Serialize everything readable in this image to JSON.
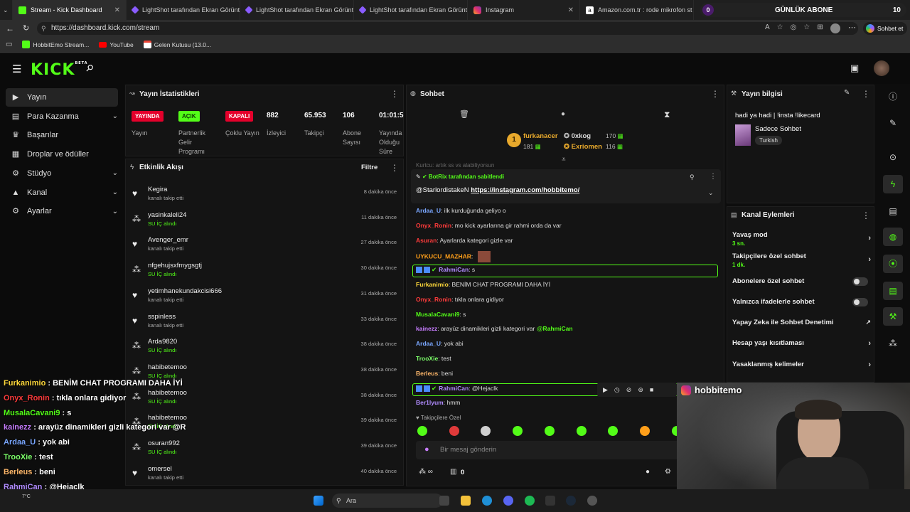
{
  "browser": {
    "tabs": [
      {
        "label": "Stream - Kick Dashboard",
        "active": true
      },
      {
        "label": "LightShot tarafından Ekran Görünt"
      },
      {
        "label": "LightShot tarafından Ekran Görünt"
      },
      {
        "label": "LightShot tarafından Ekran Görünt"
      },
      {
        "label": "Instagram"
      },
      {
        "label": "Amazon.com.tr : rode mikrofon st"
      }
    ],
    "overlay_tab_badge": "0",
    "overlay_tab_text": "GÜNLÜK ABONE",
    "overlay_tab_count": "10",
    "url": "https://dashboard.kick.com/stream",
    "profile_button": "Sohbet et",
    "bookmarks": [
      "HobbitEmo Stream...",
      "YouTube",
      "Gelen Kutusu (13.0..."
    ]
  },
  "brand": {
    "logo": "KICK",
    "beta": "BETA",
    "accent": "#53fc18"
  },
  "sidebar": {
    "items": [
      {
        "label": "Yayın",
        "icon": "video-icon",
        "active": true
      },
      {
        "label": "Para Kazanma",
        "icon": "money-icon",
        "expandable": true
      },
      {
        "label": "Başarılar",
        "icon": "trophy-icon"
      },
      {
        "label": "Droplar ve ödüller",
        "icon": "gift-icon"
      },
      {
        "label": "Stüdyo",
        "icon": "gear-icon",
        "expandable": true
      },
      {
        "label": "Kanal",
        "icon": "user-icon",
        "expandable": true
      },
      {
        "label": "Ayarlar",
        "icon": "settings-icon",
        "expandable": true
      }
    ]
  },
  "stats": {
    "title": "Yayın İstatistikleri",
    "items": [
      {
        "value": "YAYINDA",
        "label": "Yayın",
        "type": "badge",
        "color": "#e4002b"
      },
      {
        "value": "AÇIK",
        "label": "Partnerlik Gelir Programı",
        "type": "badge",
        "color": "#53fc18"
      },
      {
        "value": "KAPALI",
        "label": "Çoklu Yayın",
        "type": "badge",
        "color": "#e4002b"
      },
      {
        "value": "882",
        "label": "İzleyici"
      },
      {
        "value": "65.953",
        "label": "Takipçi"
      },
      {
        "value": "106",
        "label": "Abone Sayısı"
      },
      {
        "value": "01:01:5",
        "label": "Yayında Olduğu Süre"
      }
    ]
  },
  "activity": {
    "title": "Etkinlik Akışı",
    "filter": "Filtre",
    "events": [
      {
        "name": "Kegira",
        "desc": "kanalı takip etti",
        "time": "8 dakika önce",
        "type": "follow"
      },
      {
        "name": "yasinkaleli24",
        "desc": "SU İÇ alındı",
        "time": "11 dakika önce",
        "type": "reward"
      },
      {
        "name": "Avenger_emr",
        "desc": "kanalı takip etti",
        "time": "27 dakika önce",
        "type": "follow"
      },
      {
        "name": "nfgehujsxfmygsgtj",
        "desc": "SU İÇ alındı",
        "time": "30 dakika önce",
        "type": "reward"
      },
      {
        "name": "yetimhanekundakcisi666",
        "desc": "kanalı takip etti",
        "time": "31 dakika önce",
        "type": "follow"
      },
      {
        "name": "sspinless",
        "desc": "kanalı takip etti",
        "time": "33 dakika önce",
        "type": "follow"
      },
      {
        "name": "Arda9820",
        "desc": "SU İÇ alındı",
        "time": "38 dakika önce",
        "type": "reward"
      },
      {
        "name": "habibetemoo",
        "desc": "SU İÇ alındı",
        "time": "38 dakika önce",
        "type": "reward"
      },
      {
        "name": "habibetemoo",
        "desc": "SU İÇ alındı",
        "time": "38 dakika önce",
        "type": "reward"
      },
      {
        "name": "habibetemoo",
        "desc": "SU İÇ alındı",
        "time": "39 dakika önce",
        "type": "reward"
      },
      {
        "name": "osuran992",
        "desc": "SU İÇ alındı",
        "time": "39 dakika önce",
        "type": "reward"
      },
      {
        "name": "omersel",
        "desc": "kanalı takip etti",
        "time": "40 dakika önce",
        "type": "follow"
      }
    ]
  },
  "chat": {
    "title": "Sohbet",
    "top_gifter": {
      "rank": "1",
      "name": "furkanacer",
      "count": "181"
    },
    "gifters": [
      {
        "name": "0xkog",
        "count": "170"
      },
      {
        "name": "Exriomen",
        "count": "116"
      }
    ],
    "pinned_by": "BotRix tarafından sabitlendi",
    "pinned_mention": "@StarlordistakeN",
    "pinned_link": "https://instagram.com/hobbitemo/",
    "cut_line": "Kurtcu: artık ss vs alabiliyorsun",
    "messages": [
      {
        "user": "Ardaa_U",
        "color": "#7aa7ff",
        "text": "ilk kurduğunda geliyo o"
      },
      {
        "user": "Onyx_Ronin",
        "color": "#ff3b3b",
        "text": "mo kick ayarlarına gir rahmi orda da var"
      },
      {
        "user": "Asuran",
        "color": "#ff3b3b",
        "text": "Ayarlarda kategori gizle var"
      },
      {
        "user": "UYKUCU_MAZHAR",
        "color": "#ff9f1a",
        "text": ""
      },
      {
        "user": "RahmiCan",
        "color": "#b18cff",
        "text": "s",
        "highlight": true
      },
      {
        "user": "Furkanimio",
        "color": "#ffd93b",
        "text": "BENİM CHAT PROGRAMI DAHA İYİ"
      },
      {
        "user": "Onyx_Ronin",
        "color": "#ff3b3b",
        "text": "tıkla onlara gidiyor"
      },
      {
        "user": "MusalaCavani9",
        "color": "#53fc18",
        "text": "s"
      },
      {
        "user": "kainezz",
        "color": "#c77dff",
        "text": "arayüz dinamikleri gizli kategori var",
        "mention": "@RahmiCan"
      },
      {
        "user": "Ardaa_U",
        "color": "#7aa7ff",
        "text": "yok abi"
      },
      {
        "user": "TrooXie",
        "color": "#7dff6a",
        "text": "test"
      },
      {
        "user": "Berleus",
        "color": "#ffb86b",
        "text": "beni"
      },
      {
        "user": "RahmiCan",
        "color": "#b18cff",
        "text": "@Hejaclk",
        "highlight": true
      },
      {
        "user": "Ber1lyum",
        "color": "#b18cff",
        "text": "hmm"
      }
    ],
    "emote_label": "Takipçilere Özel",
    "input_placeholder": "Bir mesaj gönderin",
    "points": "0"
  },
  "stream_info": {
    "title": "Yayın bilgisi",
    "stream_title": "hadi ya hadi | !insta !likecard",
    "category": "Sadece Sohbet",
    "tag": "Turkish"
  },
  "channel_actions": {
    "title": "Kanal Eylemleri",
    "items": [
      {
        "label": "Yavaş mod",
        "sub": "3 sn.",
        "control": "chevron"
      },
      {
        "label": "Takipçilere özel sohbet",
        "sub": "1 dk.",
        "control": "chevron"
      },
      {
        "label": "Abonelere özel sohbet",
        "control": "toggle"
      },
      {
        "label": "Yalnızca ifadelerle sohbet",
        "control": "toggle"
      },
      {
        "label": "Yapay Zeka ile Sohbet Denetimi",
        "control": "external"
      },
      {
        "label": "Hesap yaşı kısıtlaması",
        "control": "chevron"
      },
      {
        "label": "Yasaklanmış kelimeler",
        "control": "chevron"
      }
    ]
  },
  "overlay_chat": [
    {
      "user": "Furkanimio",
      "color": "#ffd93b",
      "text": "BENİM CHAT PROGRAMI DAHA İYİ"
    },
    {
      "user": "Onyx_Ronin",
      "color": "#ff3b3b",
      "text": "tıkla onlara gidiyor"
    },
    {
      "user": "MusalaCavani9",
      "color": "#53fc18",
      "text": "s"
    },
    {
      "user": "kainezz",
      "color": "#c77dff",
      "text": "arayüz dinamikleri gizli kategori var @R"
    },
    {
      "user": "Ardaa_U",
      "color": "#7aa7ff",
      "text": "yok abi"
    },
    {
      "user": "TrooXie",
      "color": "#7dff6a",
      "text": "test"
    },
    {
      "user": "Berleus",
      "color": "#ffb86b",
      "text": "beni"
    },
    {
      "user": "RahmiCan",
      "color": "#b18cff",
      "text": "@Hejaclk"
    },
    {
      "user": "Ber1lyum",
      "color": "#b18cff",
      "text": "hmm"
    }
  ],
  "webcam": {
    "handle": "hobbitemo"
  },
  "taskbar": {
    "search": "Ara",
    "temp": "7°C"
  }
}
